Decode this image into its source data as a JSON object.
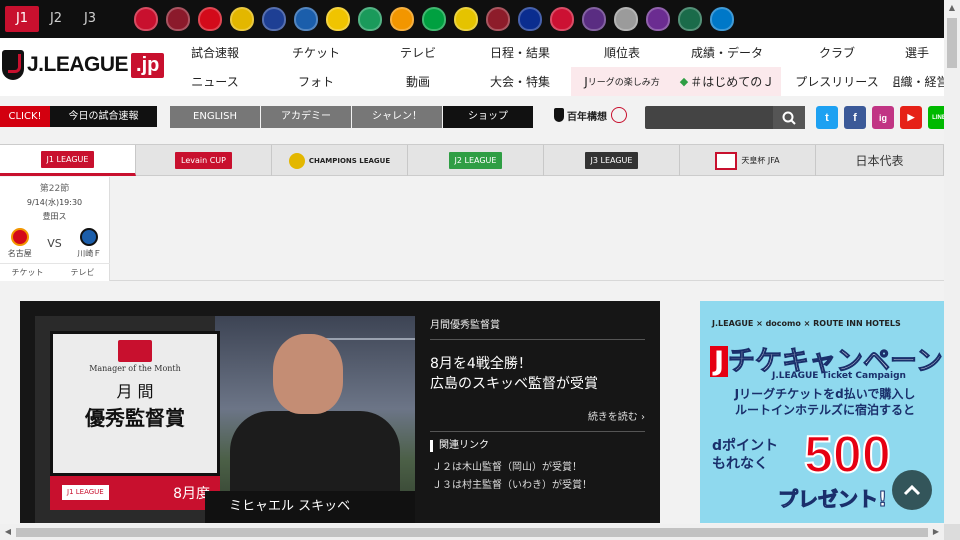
{
  "division_tabs": [
    "J1",
    "J2",
    "J3"
  ],
  "club_colors": [
    "#c8102e",
    "#8b1a2b",
    "#d30a1a",
    "#e3b700",
    "#1e3f94",
    "#1b5eab",
    "#f0c400",
    "#1a9a5b",
    "#f29600",
    "#00a040",
    "#e5c300",
    "#8d1c2a",
    "#0a2d8f",
    "#cc1133",
    "#5a2d82",
    "#9b9b9b",
    "#6b2c91",
    "#1a6b4a",
    "#0078c8"
  ],
  "header": {
    "logo_text": "J.LEAGUE",
    "logo_jp": ".jp",
    "nav_row1": [
      "試合速報",
      "チケット",
      "テレビ",
      "日程・結果",
      "順位表",
      "成績・データ",
      "クラブ",
      "選手"
    ],
    "nav_row2": [
      "ニュース",
      "フォト",
      "動画",
      "大会・特集",
      "リーグの楽しみ方",
      "＃はじめてのＪ",
      "プレスリリース",
      "組織・経営"
    ],
    "nav_row2_j": "J"
  },
  "subbar": {
    "click": "CLICK!",
    "today": "今日の試合速報",
    "tabs": [
      "ENGLISH",
      "アカデミー",
      "シャレン！",
      "ショップ"
    ],
    "hyaku": "百年構想",
    "search_placeholder": "",
    "socials": [
      "t",
      "f",
      "ig",
      "▶",
      "LINE"
    ]
  },
  "competitions": [
    "J1 LEAGUE",
    "Levain CUP",
    "CHAMPIONS LEAGUE",
    "J2 LEAGUE",
    "J3 LEAGUE",
    "天皇杯 JFA",
    "日本代表"
  ],
  "match": {
    "section": "第22節",
    "date": "9/14(水)19:30",
    "venue": "豊田ス",
    "home": "名古屋",
    "vs": "VS",
    "away": "川崎Ｆ",
    "link_ticket": "チケット",
    "link_tv": "テレビ"
  },
  "feature": {
    "label": "月間優秀監督賞",
    "title_line1": "8月を4戦全勝！",
    "title_line2": "広島のスキッベ監督が受賞",
    "more": "続きを読む",
    "related_label": "関連リンク",
    "related_links": [
      "Ｊ２は木山監督（岡山）が受賞！",
      "Ｊ３は村主監督（いわき）が受賞！"
    ],
    "card_en": "Manager of the Month",
    "card_jp1": "月 間",
    "card_jp2": "優秀監督賞",
    "card_footer": "J1 LEAGUE",
    "card_month": "8月度",
    "name_bar": "ミヒャエル スキッベ"
  },
  "promo": {
    "logos": "J.LEAGUE × docomo × ROUTE INN HOTELS",
    "title_j": "J",
    "title": "チケキャンペーン",
    "subtitle": "J.LEAGUE Ticket Campaign",
    "body": "Jリーグチケットをd払いで購入し ルートインホテルズに宿泊すると",
    "d_line1": "dポイント",
    "d_line2": "もれなく",
    "amount": "500",
    "present": "プレゼント!"
  }
}
